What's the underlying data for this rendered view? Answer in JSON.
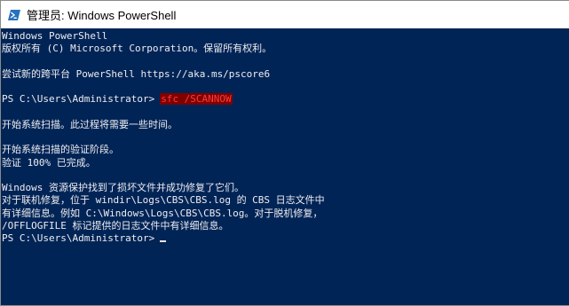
{
  "window": {
    "title": "管理员: Windows PowerShell",
    "icon": "powershell-icon"
  },
  "colors": {
    "console_bg": "#012456",
    "console_fg": "#eeedf0",
    "command_bg": "#800000",
    "command_fg": "#ff3b3b"
  },
  "console": {
    "banner_line1": "Windows PowerShell",
    "banner_line2": "版权所有 (C) Microsoft Corporation。保留所有权利。",
    "tip_line": "尝试新的跨平台 PowerShell https://aka.ms/pscore6",
    "prompt1": "PS C:\\Users\\Administrator>",
    "command": "sfc /SCANNOW",
    "scan_start": "开始系统扫描。此过程将需要一些时间。",
    "verify_start": "开始系统扫描的验证阶段。",
    "verify_done": "验证 100% 已完成。",
    "result_line1": "Windows 资源保护找到了损坏文件并成功修复了它们。",
    "result_line2": "对于联机修复，位于 windir\\Logs\\CBS\\CBS.log 的 CBS 日志文件中",
    "result_line3": "有详细信息。例如 C:\\Windows\\Logs\\CBS\\CBS.log。对于脱机修复，",
    "result_line4": "/OFFLOGFILE 标记提供的日志文件中有详细信息。",
    "prompt2": "PS C:\\Users\\Administrator>"
  }
}
